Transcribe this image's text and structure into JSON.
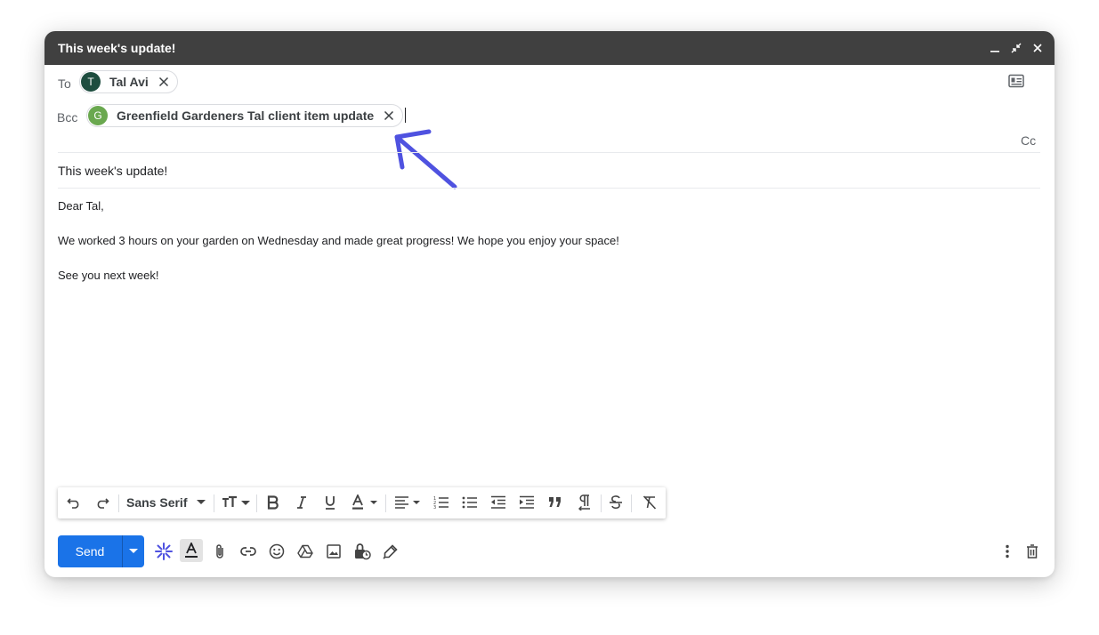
{
  "window": {
    "title": "This week's update!"
  },
  "recipients": {
    "to_label": "To",
    "to_chip": {
      "initial": "T",
      "name": "Tal Avi",
      "avatar_color": "#1e4d3f"
    },
    "bcc_label": "Bcc",
    "bcc_chip": {
      "initial": "G",
      "name": "Greenfield Gardeners Tal client item update",
      "avatar_color": "#6aa84f"
    },
    "cc_label": "Cc"
  },
  "subject": "This week's update!",
  "body": {
    "greeting": "Dear Tal,",
    "paragraph": "We worked 3 hours on your garden on Wednesday and made great progress! We hope you enjoy your space!",
    "closing": "See you next week!"
  },
  "formatting": {
    "font": "Sans Serif",
    "icons": [
      "undo-icon",
      "redo-icon",
      "text-size-icon",
      "bold-icon",
      "italic-icon",
      "underline-icon",
      "text-color-icon",
      "align-icon",
      "numbered-list-icon",
      "bulleted-list-icon",
      "indent-less-icon",
      "indent-more-icon",
      "quote-icon",
      "rtl-icon",
      "strikethrough-icon",
      "remove-formatting-icon"
    ]
  },
  "actions": {
    "send_label": "Send"
  },
  "colors": {
    "accent": "#1a73e8",
    "titlebar": "#404040",
    "annotation_arrow": "#4f52e0"
  }
}
